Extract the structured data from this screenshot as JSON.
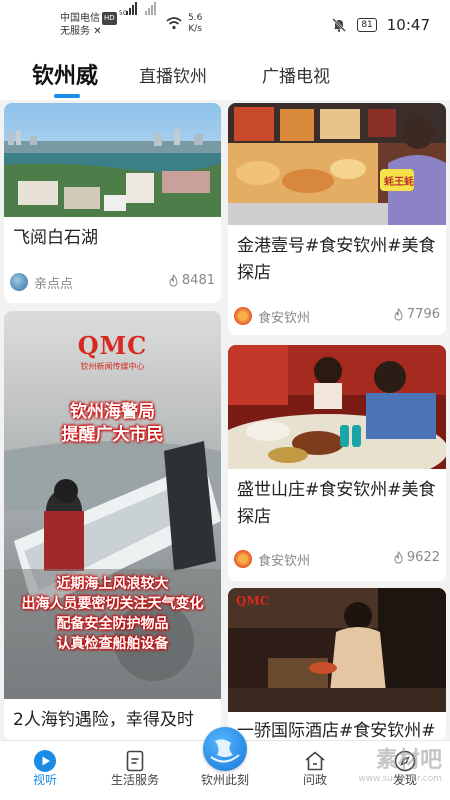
{
  "status_bar": {
    "carrier": "中国电信",
    "carrier_badge": "HD",
    "service": "无服务",
    "network": "5G",
    "speed_value": "5.6",
    "speed_unit": "K/s",
    "battery": "81",
    "time": "10:47"
  },
  "tabs": [
    {
      "label": "钦州威",
      "active": true
    },
    {
      "label": "直播钦州",
      "active": false
    },
    {
      "label": "广播电视",
      "active": false
    }
  ],
  "cards": [
    {
      "title": "飞阅白石湖",
      "author": "亲点点",
      "views": "8481"
    },
    {
      "title": "金港壹号#食安钦州#美食探店",
      "author": "食安钦州",
      "views": "7796",
      "poster_tag": "蚝王蚝"
    },
    {
      "title": "2人海钓遇险，幸得及时",
      "overlay_lines": [
        "钦州海警局",
        "提醒广大市民",
        "近期海上风浪较大",
        "出海人员要密切关注天气变化",
        "配备安全防护物品",
        "认真检查船舶设备"
      ],
      "logo": "QMC",
      "logo_sub": "钦州新闻传媒中心"
    },
    {
      "title": "盛世山庄#食安钦州#美食探店",
      "author": "食安钦州",
      "views": "9622"
    },
    {
      "title": "一骄国际酒店#食安钦州#",
      "logo": "QMC"
    }
  ],
  "bottom_nav": [
    {
      "label": "视听",
      "active": true
    },
    {
      "label": "生活服务",
      "active": false
    },
    {
      "label": "钦州此刻",
      "active": false
    },
    {
      "label": "问政",
      "active": false
    },
    {
      "label": "发现",
      "active": false
    }
  ],
  "watermark": {
    "line1": "素材吧",
    "line2": "www.sucaibar.com"
  },
  "colors": {
    "accent": "#1a8be6",
    "logo_red": "#d8281f"
  }
}
